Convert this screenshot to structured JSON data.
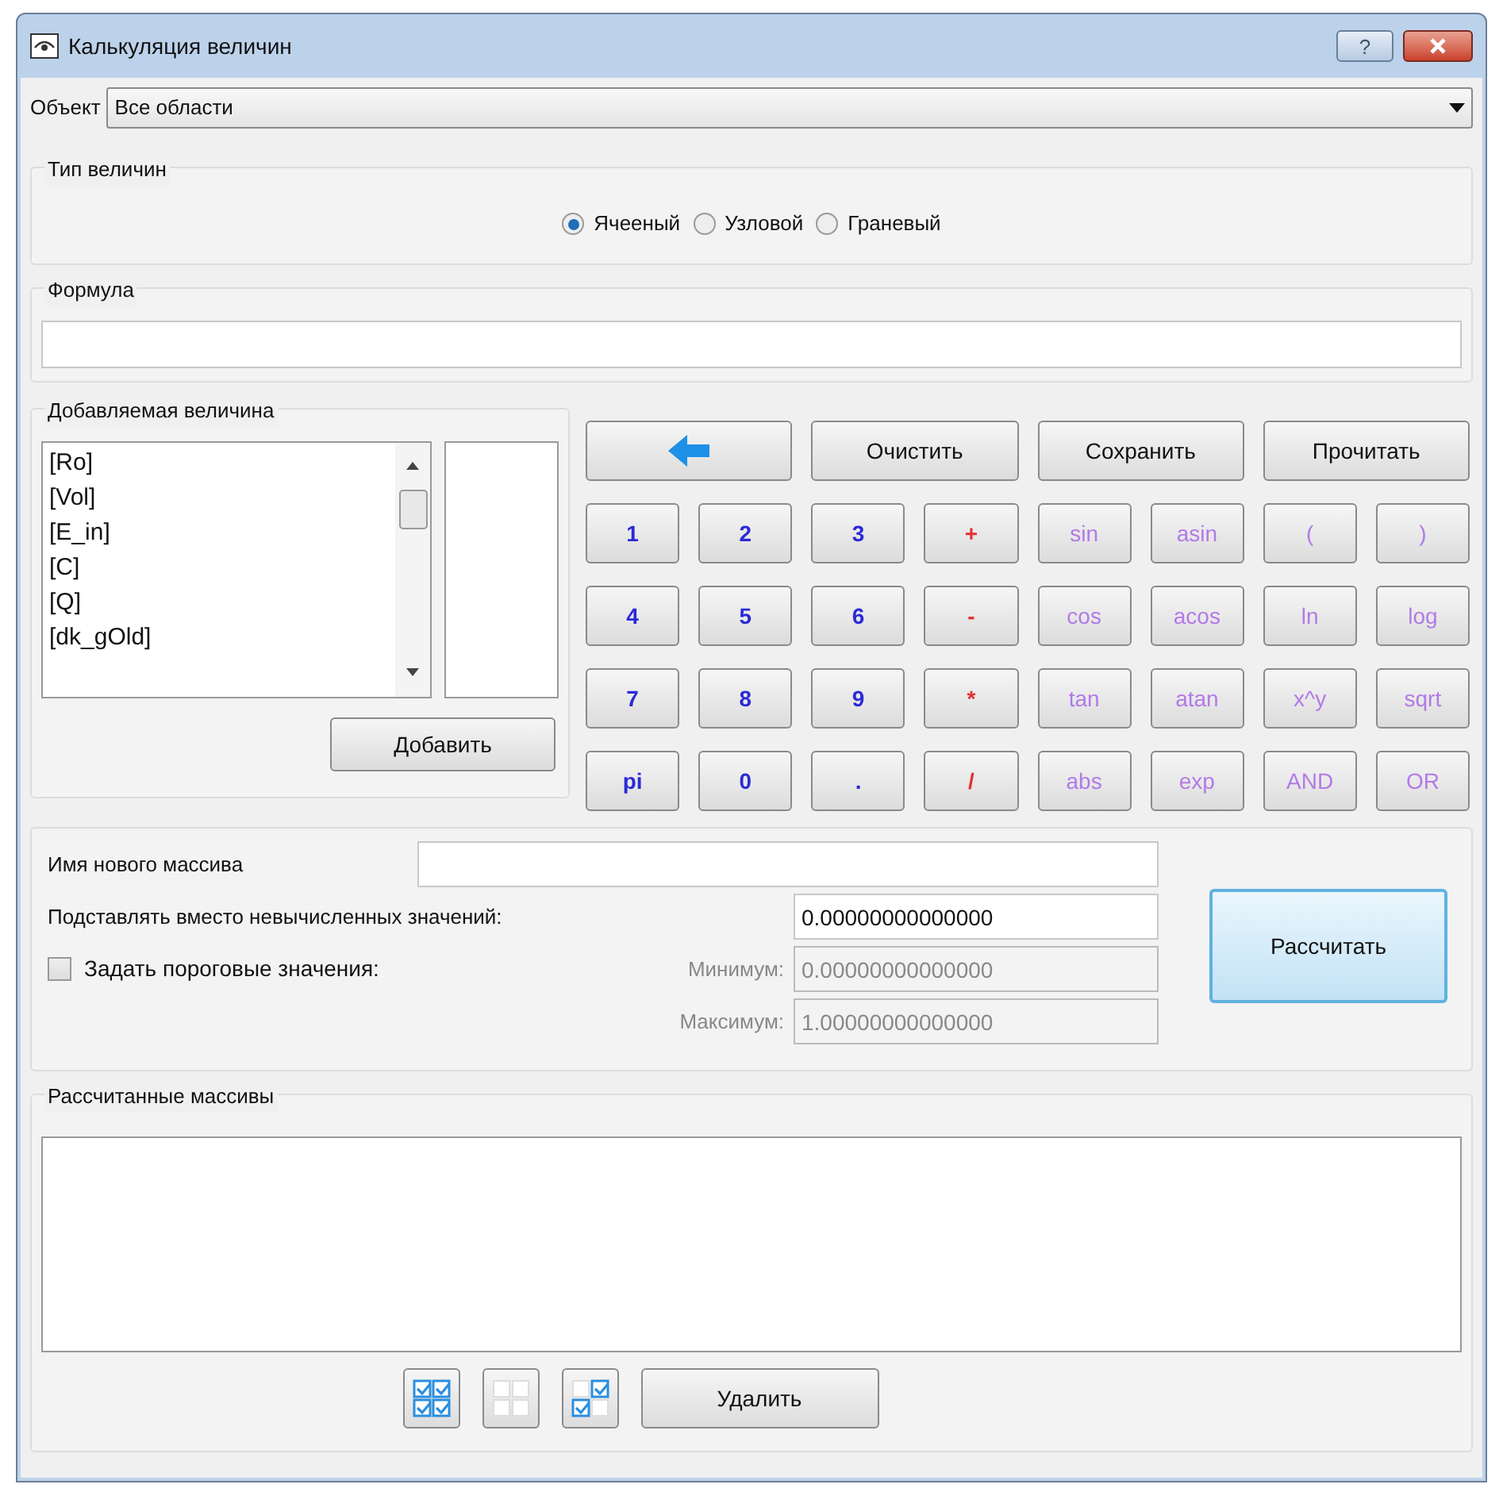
{
  "window": {
    "title": "Калькуляция величин",
    "buttons": [
      "?"
    ]
  },
  "object": {
    "label": "Объект",
    "value": "Все области"
  },
  "value_type": {
    "title": "Тип величин",
    "options": [
      {
        "label": "Ячееный",
        "selected": true
      },
      {
        "label": "Узловой",
        "selected": false
      },
      {
        "label": "Граневый",
        "selected": false
      }
    ]
  },
  "formula": {
    "title": "Формула"
  },
  "added_value": {
    "title": "Добавляемая величина",
    "items": [
      "[Ro]",
      "[Vol]",
      "[E_in]",
      "[C]",
      "[Q]",
      "[dk_gOld]"
    ],
    "add_button": "Добавить"
  },
  "top_buttons": [
    "Очистить",
    "Сохранить",
    "Прочитать"
  ],
  "keys": [
    {
      "label": "1",
      "kind": "digit"
    },
    {
      "label": "2",
      "kind": "digit"
    },
    {
      "label": "3",
      "kind": "digit"
    },
    {
      "label": "+",
      "kind": "op"
    },
    {
      "label": "sin",
      "kind": "func"
    },
    {
      "label": "asin",
      "kind": "func"
    },
    {
      "label": "(",
      "kind": "func"
    },
    {
      "label": ")",
      "kind": "func"
    },
    {
      "label": "4",
      "kind": "digit"
    },
    {
      "label": "5",
      "kind": "digit"
    },
    {
      "label": "6",
      "kind": "digit"
    },
    {
      "label": "-",
      "kind": "op"
    },
    {
      "label": "cos",
      "kind": "func"
    },
    {
      "label": "acos",
      "kind": "func"
    },
    {
      "label": "ln",
      "kind": "func"
    },
    {
      "label": "log",
      "kind": "func"
    },
    {
      "label": "7",
      "kind": "digit"
    },
    {
      "label": "8",
      "kind": "digit"
    },
    {
      "label": "9",
      "kind": "digit"
    },
    {
      "label": "*",
      "kind": "op"
    },
    {
      "label": "tan",
      "kind": "func"
    },
    {
      "label": "atan",
      "kind": "func"
    },
    {
      "label": "x^y",
      "kind": "func"
    },
    {
      "label": "sqrt",
      "kind": "func"
    },
    {
      "label": "pi",
      "kind": "digit"
    },
    {
      "label": "0",
      "kind": "digit"
    },
    {
      "label": ".",
      "kind": "digit"
    },
    {
      "label": "/",
      "kind": "op"
    },
    {
      "label": "abs",
      "kind": "func"
    },
    {
      "label": "exp",
      "kind": "func"
    },
    {
      "label": "AND",
      "kind": "func"
    },
    {
      "label": "OR",
      "kind": "func"
    }
  ],
  "settings": {
    "name_label": "Имя нового массива",
    "substitute_label": "Подставлять вместо невычисленных значений:",
    "substitute_value": "0.00000000000000",
    "threshold": {
      "label": "Задать пороговые значения:",
      "checked": false
    },
    "min_label": "Минимум:",
    "min_value": "0.00000000000000",
    "max_label": "Максимум:",
    "max_value": "1.00000000000000",
    "disabled": true,
    "calculate_button": "Рассчитать"
  },
  "results": {
    "title": "Рассчитанные массивы",
    "delete_button": "Удалить"
  }
}
